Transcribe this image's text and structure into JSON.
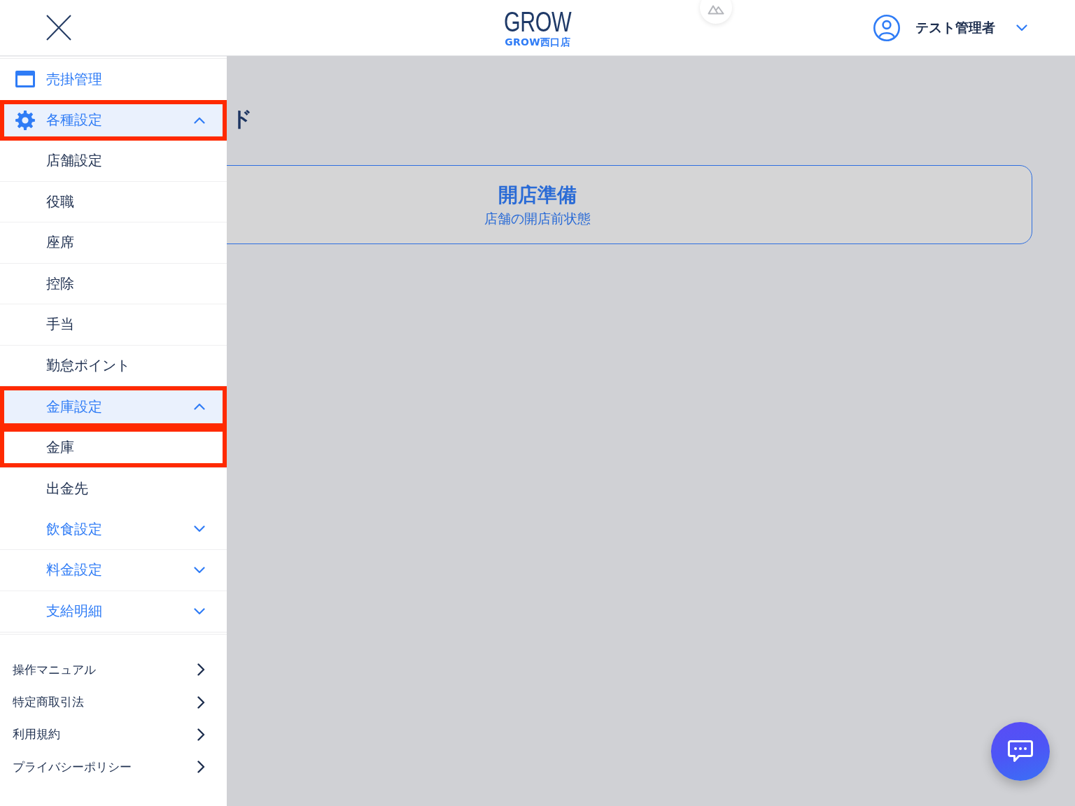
{
  "header": {
    "logo": "GROW",
    "store": "GROW西口店",
    "user_name": "テスト管理者"
  },
  "main": {
    "title": "ド",
    "status_card": {
      "title": "開店準備",
      "description": "店舗の開店前状態"
    }
  },
  "sidebar": {
    "items": [
      {
        "label": "売掛管理",
        "kind": "link",
        "highlighted": false
      },
      {
        "label": "各種設定",
        "kind": "group",
        "expanded": true,
        "highlighted": true,
        "children": [
          {
            "label": "店舗設定",
            "kind": "link",
            "highlighted": false
          },
          {
            "label": "役職",
            "kind": "link",
            "highlighted": false
          },
          {
            "label": "座席",
            "kind": "link",
            "highlighted": false
          },
          {
            "label": "控除",
            "kind": "link",
            "highlighted": false
          },
          {
            "label": "手当",
            "kind": "link",
            "highlighted": false
          },
          {
            "label": "勤怠ポイント",
            "kind": "link",
            "highlighted": false
          },
          {
            "label": "金庫設定",
            "kind": "group",
            "expanded": true,
            "highlighted": true,
            "children": [
              {
                "label": "金庫",
                "kind": "link",
                "highlighted": true
              },
              {
                "label": "出金先",
                "kind": "link",
                "highlighted": false
              }
            ]
          },
          {
            "label": "飲食設定",
            "kind": "group",
            "expanded": false,
            "highlighted": false
          },
          {
            "label": "料金設定",
            "kind": "group",
            "expanded": false,
            "highlighted": false
          },
          {
            "label": "支給明細",
            "kind": "group",
            "expanded": false,
            "highlighted": false
          }
        ]
      }
    ],
    "footer_links": [
      "操作マニュアル",
      "特定商取引法",
      "利用規約",
      "プライバシーポリシー"
    ]
  }
}
